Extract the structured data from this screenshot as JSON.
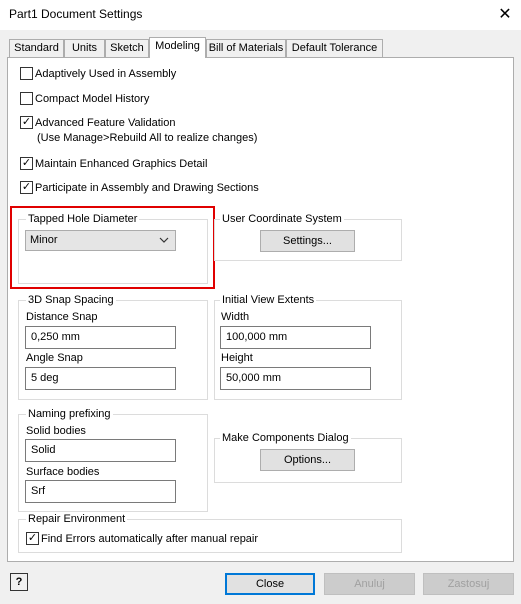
{
  "window": {
    "title": "Part1 Document Settings"
  },
  "tabs": [
    {
      "label": "Standard"
    },
    {
      "label": "Units"
    },
    {
      "label": "Sketch"
    },
    {
      "label": "Modeling",
      "active": true
    },
    {
      "label": "Bill of Materials"
    },
    {
      "label": "Default Tolerance"
    }
  ],
  "options": {
    "adaptively_used": {
      "label": "Adaptively Used in Assembly",
      "checked": false
    },
    "compact_history": {
      "label": "Compact Model History",
      "checked": false
    },
    "advanced_validation": {
      "label": "Advanced Feature Validation",
      "sublabel": "(Use Manage>Rebuild All to realize changes)",
      "checked": true
    },
    "enhanced_graphics": {
      "label": "Maintain Enhanced Graphics Detail",
      "checked": true
    },
    "participate_sections": {
      "label": "Participate in Assembly and Drawing Sections",
      "checked": true
    }
  },
  "tapped_hole": {
    "title": "Tapped Hole Diameter",
    "value": "Minor"
  },
  "ucs": {
    "title": "User Coordinate System",
    "button": "Settings..."
  },
  "snap": {
    "title": "3D Snap Spacing",
    "distance_label": "Distance Snap",
    "distance_value": "0,250 mm",
    "angle_label": "Angle Snap",
    "angle_value": "5 deg"
  },
  "view_extents": {
    "title": "Initial View Extents",
    "width_label": "Width",
    "width_value": "100,000 mm",
    "height_label": "Height",
    "height_value": "50,000 mm"
  },
  "naming": {
    "title": "Naming prefixing",
    "solid_label": "Solid bodies",
    "solid_value": "Solid",
    "surface_label": "Surface bodies",
    "surface_value": "Srf"
  },
  "make_components": {
    "title": "Make Components Dialog",
    "button": "Options..."
  },
  "repair": {
    "title": "Repair Environment",
    "find_errors_label": "Find Errors automatically after manual repair",
    "checked": true
  },
  "footer": {
    "help": "?",
    "close": "Close",
    "cancel": "Anuluj",
    "apply": "Zastosuj"
  },
  "colors": {
    "highlight": "#e00000",
    "default_button_border": "#0078d7"
  }
}
